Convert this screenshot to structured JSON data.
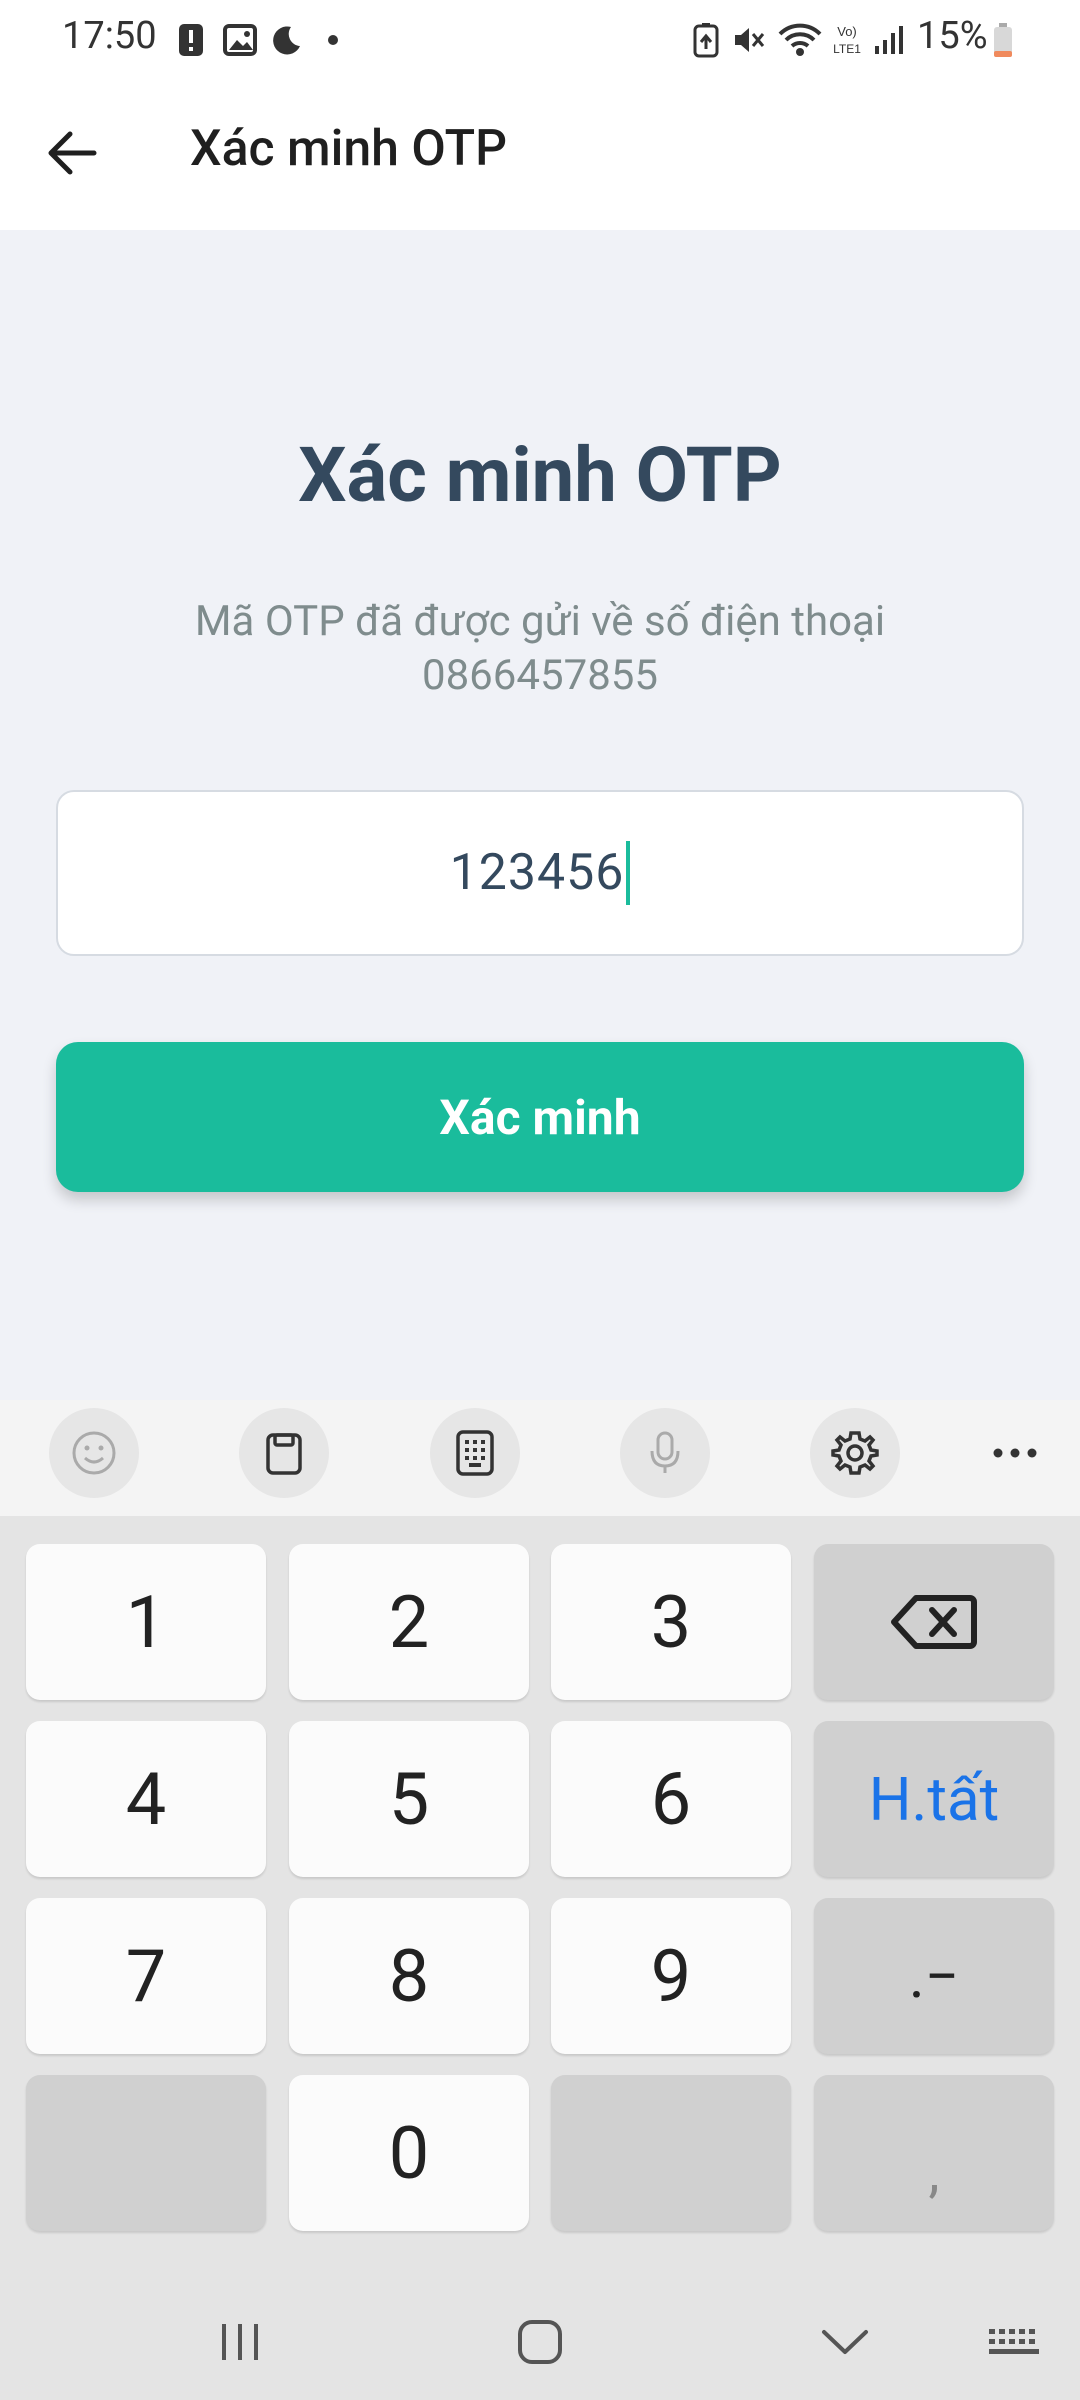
{
  "status_bar": {
    "time": "17:50",
    "battery": "15%"
  },
  "app_bar": {
    "title": "Xác minh OTP"
  },
  "main": {
    "heading": "Xác minh OTP",
    "subtitle_line1": "Mã OTP đã được gửi về số điện thoại",
    "subtitle_line2": "0866457855",
    "otp_value": "123456",
    "verify_label": "Xác minh"
  },
  "keyboard": {
    "keys": {
      "k1": "1",
      "k2": "2",
      "k3": "3",
      "k4": "4",
      "k5": "5",
      "k6": "6",
      "k7": "7",
      "k8": "8",
      "k9": "9",
      "k0": "0",
      "done": "H.tất",
      "dot_dash": ".−",
      "comma": ","
    }
  },
  "colors": {
    "accent": "#1abc9c",
    "heading": "#34495e",
    "subtitle": "#7f8c8d",
    "done_key_text": "#1a73e8"
  }
}
